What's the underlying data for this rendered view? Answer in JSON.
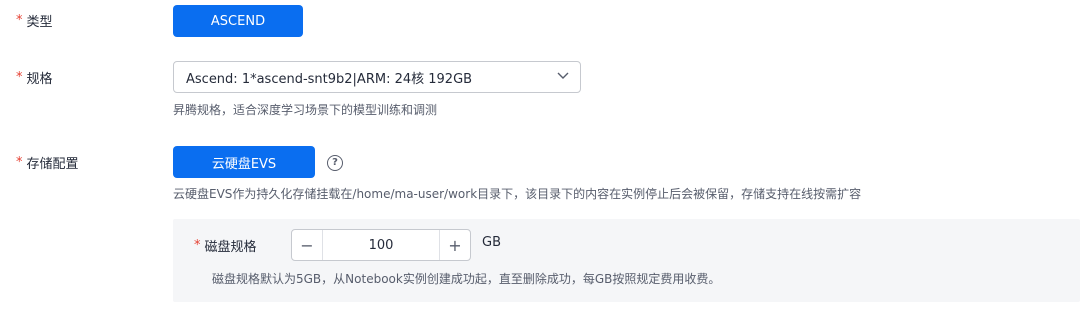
{
  "type_field": {
    "required": "*",
    "label": "类型",
    "value": "ASCEND"
  },
  "spec_field": {
    "required": "*",
    "label": "规格",
    "selected": "Ascend: 1*ascend-snt9b2|ARM: 24核 192GB",
    "hint": "昇腾规格，适合深度学习场景下的模型训练和调测"
  },
  "storage_field": {
    "required": "*",
    "label": "存储配置",
    "option": "云硬盘EVS",
    "help_glyph": "?",
    "hint": "云硬盘EVS作为持久化存储挂载在/home/ma-user/work目录下，该目录下的内容在实例停止后会被保留，存储支持在线按需扩容"
  },
  "disk_field": {
    "required": "*",
    "label": "磁盘规格",
    "decrement": "−",
    "value": "100",
    "increment": "+",
    "unit": "GB",
    "hint": "磁盘规格默认为5GB，从Notebook实例创建成功起，直至删除成功，每GB按照规定费用收费。"
  },
  "colors": {
    "primary": "#0a6ef0",
    "required": "#e53e30",
    "panel": "#f5f6f8"
  },
  "icons": {
    "dropdown": "chevron-down-icon",
    "help": "help-circle-icon"
  }
}
